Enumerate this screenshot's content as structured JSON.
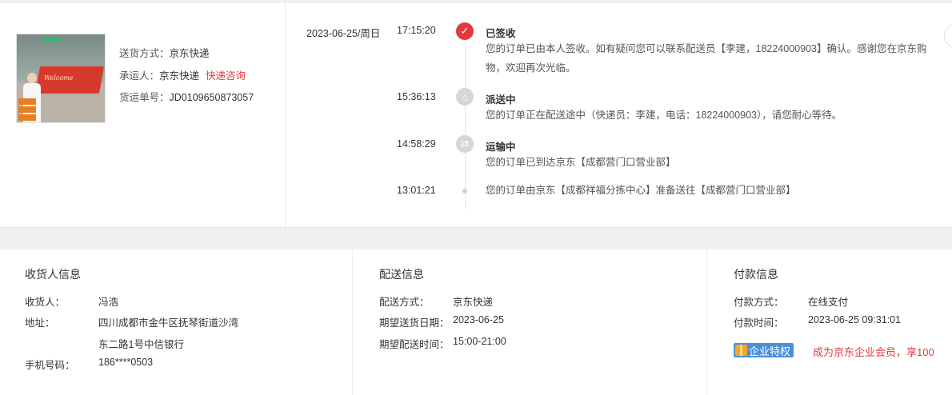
{
  "shipping": {
    "method_label": "送货方式：",
    "method_value": "京东快递",
    "carrier_label": "承运人：",
    "carrier_value": "京东快递",
    "consult_link": "快递咨询",
    "tracking_label": "货运单号：",
    "tracking_value": "JD0109650873057",
    "thumb_text": "Welcome"
  },
  "timeline": [
    {
      "date": "2023-06-25/周日",
      "time": "17:15:20",
      "title": "已签收",
      "icon": "check-icon",
      "desc": "您的订单已由本人签收。如有疑问您可以联系配送员【李建，18224000903】确认。感谢您在京东购物，欢迎再次光临。"
    },
    {
      "date": "",
      "time": "15:36:13",
      "title": "派送中",
      "icon": "delivery-icon",
      "desc": "您的订单正在配送途中（快递员：李建，电话：18224000903），请您耐心等待。"
    },
    {
      "date": "",
      "time": "14:58:29",
      "title": "运输中",
      "icon": "transit-icon",
      "desc": "您的订单已到达京东【成都营门口营业部】"
    },
    {
      "date": "",
      "time": "13:01:21",
      "title": "",
      "icon": "dot-icon",
      "desc": "您的订单由京东【成都祥福分拣中心】准备送往【成都营门口营业部】"
    }
  ],
  "receiver": {
    "title": "收货人信息",
    "name_label": "收货人：",
    "name_value": "冯浩",
    "address_label": "地址：",
    "address_line1": "四川成都市金牛区抚琴街道沙湾",
    "address_line2": "东二路1号中信银行",
    "phone_label": "手机号码：",
    "phone_value": "186****0503"
  },
  "delivery": {
    "title": "配送信息",
    "method_label": "配送方式：",
    "method_value": "京东快递",
    "date_label": "期望送货日期：",
    "date_value": "2023-06-25",
    "time_label": "期望配送时间：",
    "time_value": "15:00-21:00"
  },
  "payment": {
    "title": "付款信息",
    "method_label": "付款方式：",
    "method_value": "在线支付",
    "time_label": "付款时间：",
    "time_value": "2023-06-25 09:31:01",
    "badge": "企业特权",
    "promo": "成为京东企业会员，享100"
  },
  "colors": {
    "accent": "#e4393c",
    "badge_bg": "#4a90d9",
    "line": "#e5e5e5"
  }
}
